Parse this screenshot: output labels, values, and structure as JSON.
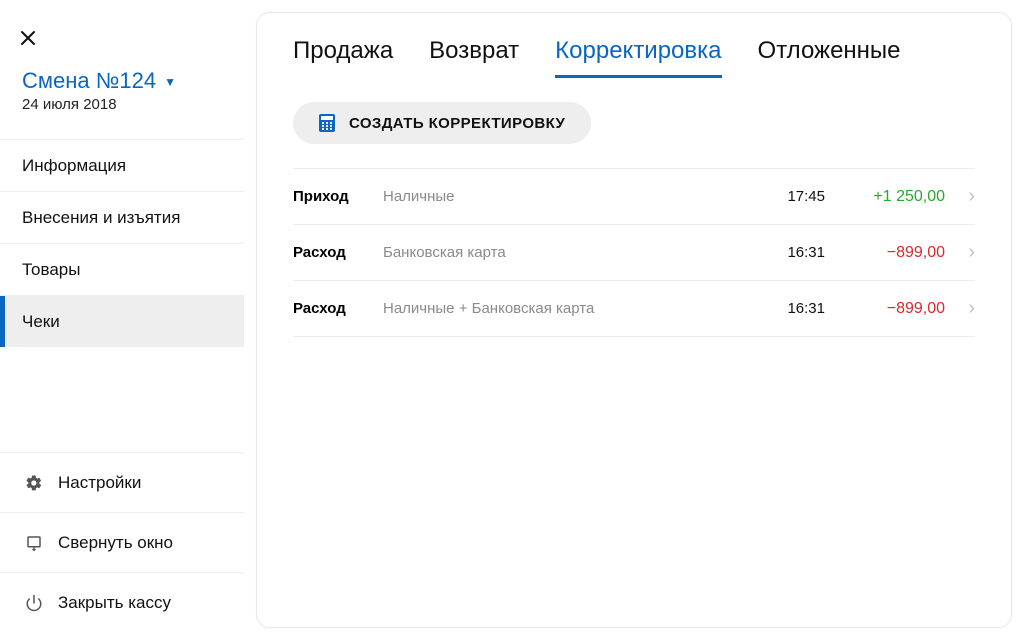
{
  "sidebar": {
    "shift_title": "Смена №124",
    "shift_date": "24 июля 2018",
    "nav": [
      {
        "label": "Информация"
      },
      {
        "label": "Внесения и изъятия"
      },
      {
        "label": "Товары"
      },
      {
        "label": "Чеки"
      }
    ],
    "active_index": 3,
    "actions": {
      "settings": "Настройки",
      "minimize": "Свернуть окно",
      "close_register": "Закрыть кассу"
    }
  },
  "tabs": [
    {
      "label": "Продажа"
    },
    {
      "label": "Возврат"
    },
    {
      "label": "Корректировка"
    },
    {
      "label": "Отложенные"
    }
  ],
  "active_tab": 2,
  "create_button": "СОЗДАТЬ КОРРЕКТИРОВКУ",
  "rows": [
    {
      "type": "Приход",
      "method": "Наличные",
      "time": "17:45",
      "amount": "+1 250,00",
      "sign": "positive"
    },
    {
      "type": "Расход",
      "method": "Банковская карта",
      "time": "16:31",
      "amount": "−899,00",
      "sign": "negative"
    },
    {
      "type": "Расход",
      "method": "Наличные + Банковская карта",
      "time": "16:31",
      "amount": "−899,00",
      "sign": "negative"
    }
  ]
}
